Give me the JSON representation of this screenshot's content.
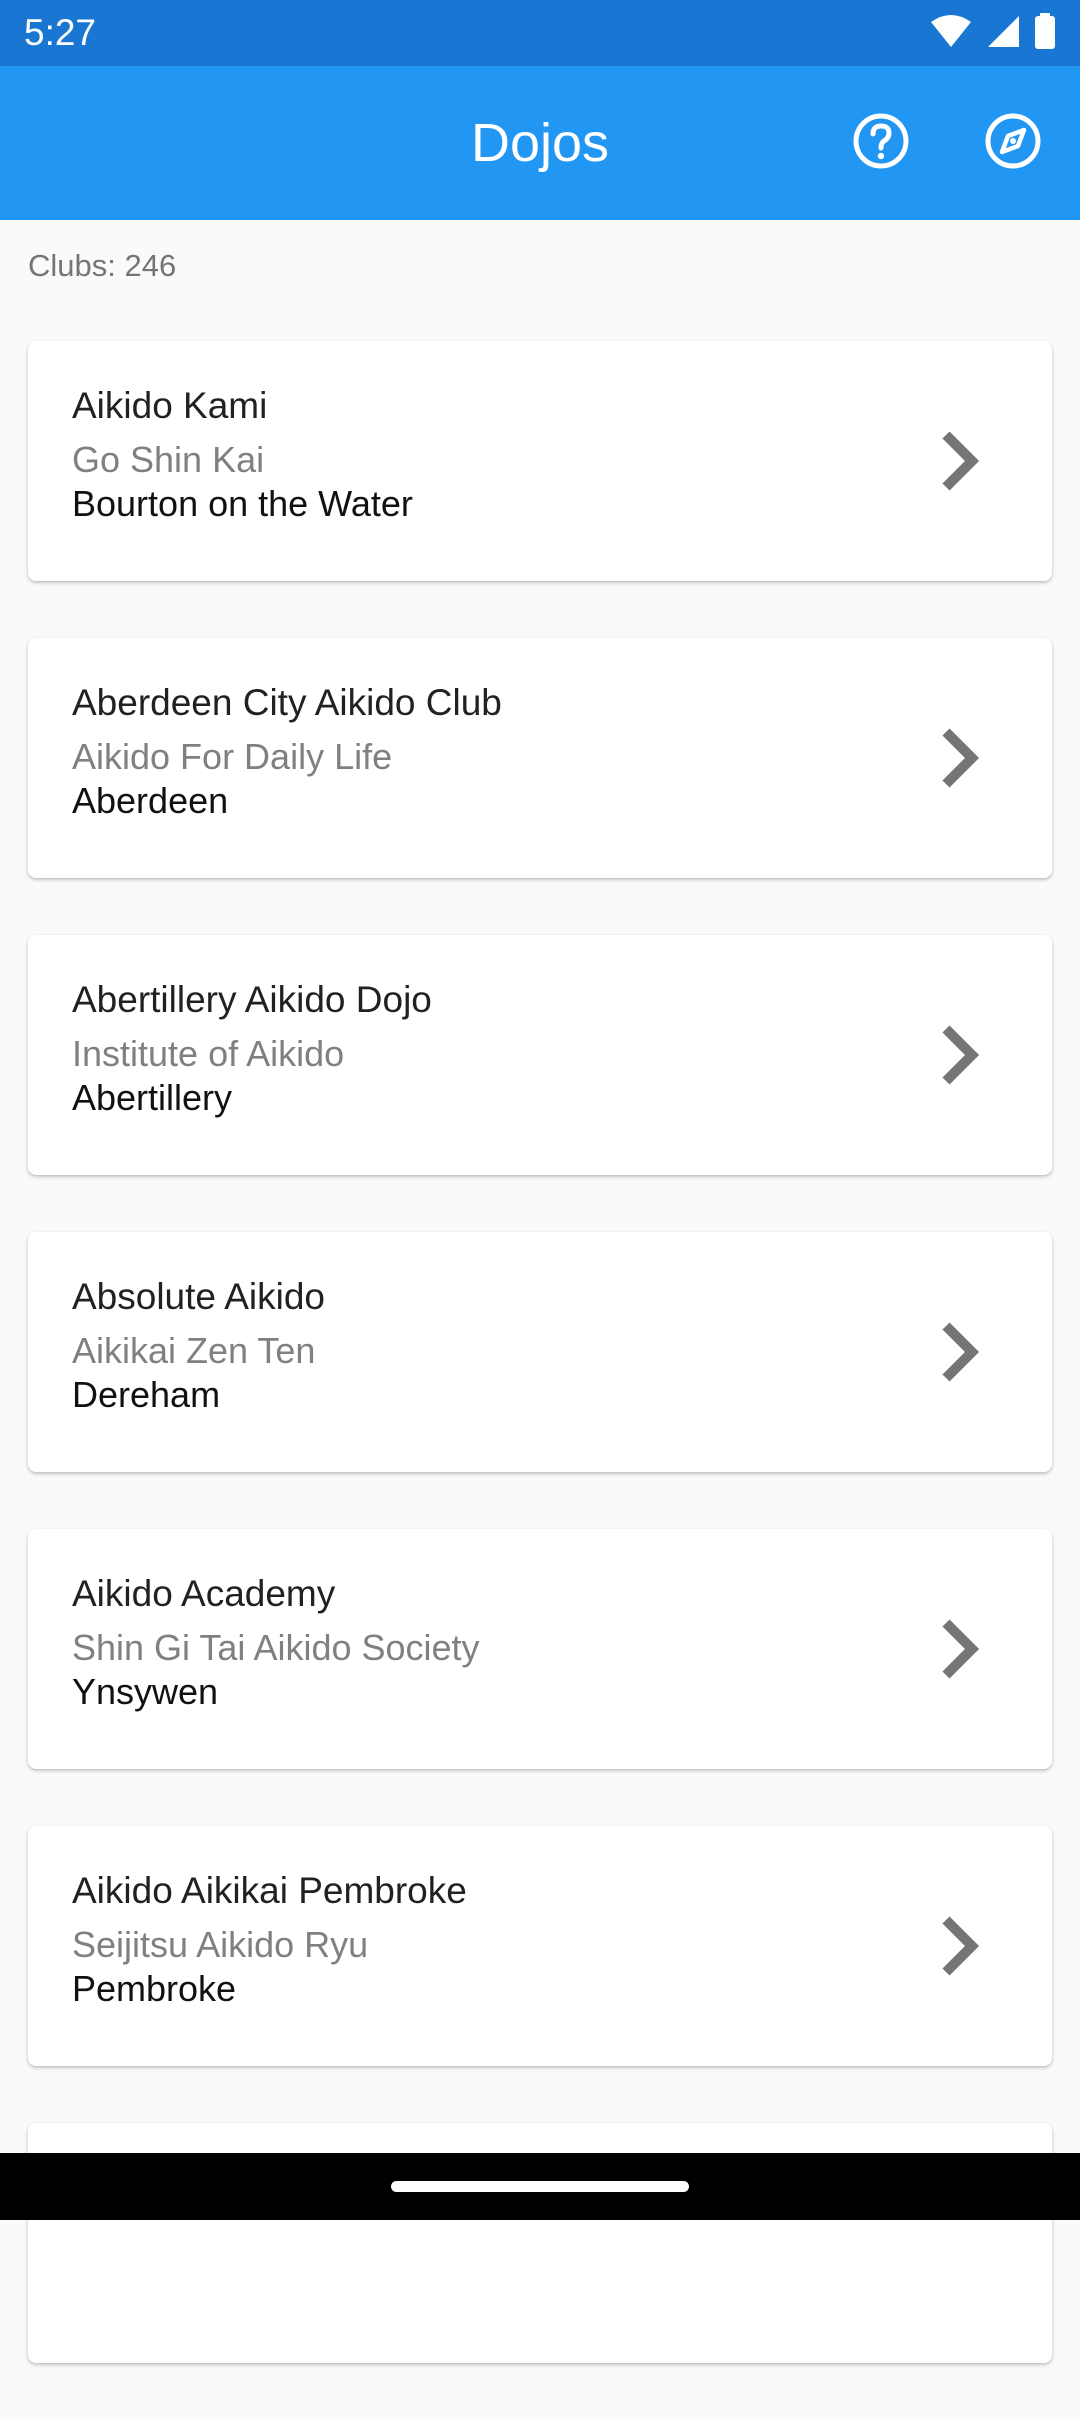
{
  "status_bar": {
    "time": "5:27",
    "icons": [
      "wifi-icon",
      "signal-icon",
      "battery-icon"
    ]
  },
  "app_bar": {
    "title": "Dojos",
    "actions": [
      "help-icon",
      "compass-icon"
    ]
  },
  "clubs_count": "Clubs: 246",
  "clubs": [
    {
      "name": "Aikido Kami",
      "organization": "Go Shin Kai",
      "town": "Bourton on the Water"
    },
    {
      "name": "Aberdeen City Aikido Club",
      "organization": "Aikido For Daily Life",
      "town": "Aberdeen"
    },
    {
      "name": "Abertillery Aikido Dojo",
      "organization": "Institute of Aikido",
      "town": "Abertillery"
    },
    {
      "name": "Absolute Aikido",
      "organization": "Aikikai Zen Ten",
      "town": "Dereham"
    },
    {
      "name": "Aikido Academy",
      "organization": "Shin Gi Tai Aikido Society",
      "town": "Ynsywen"
    },
    {
      "name": "Aikido Aikikai Pembroke",
      "organization": "Seijitsu Aikido Ryu",
      "town": "Pembroke"
    },
    {
      "name": "",
      "organization": "",
      "town": ""
    }
  ],
  "colors": {
    "status_bar": "#1976d2",
    "app_bar": "#2196f3",
    "background": "#fafafa",
    "chevron": "#757575"
  }
}
